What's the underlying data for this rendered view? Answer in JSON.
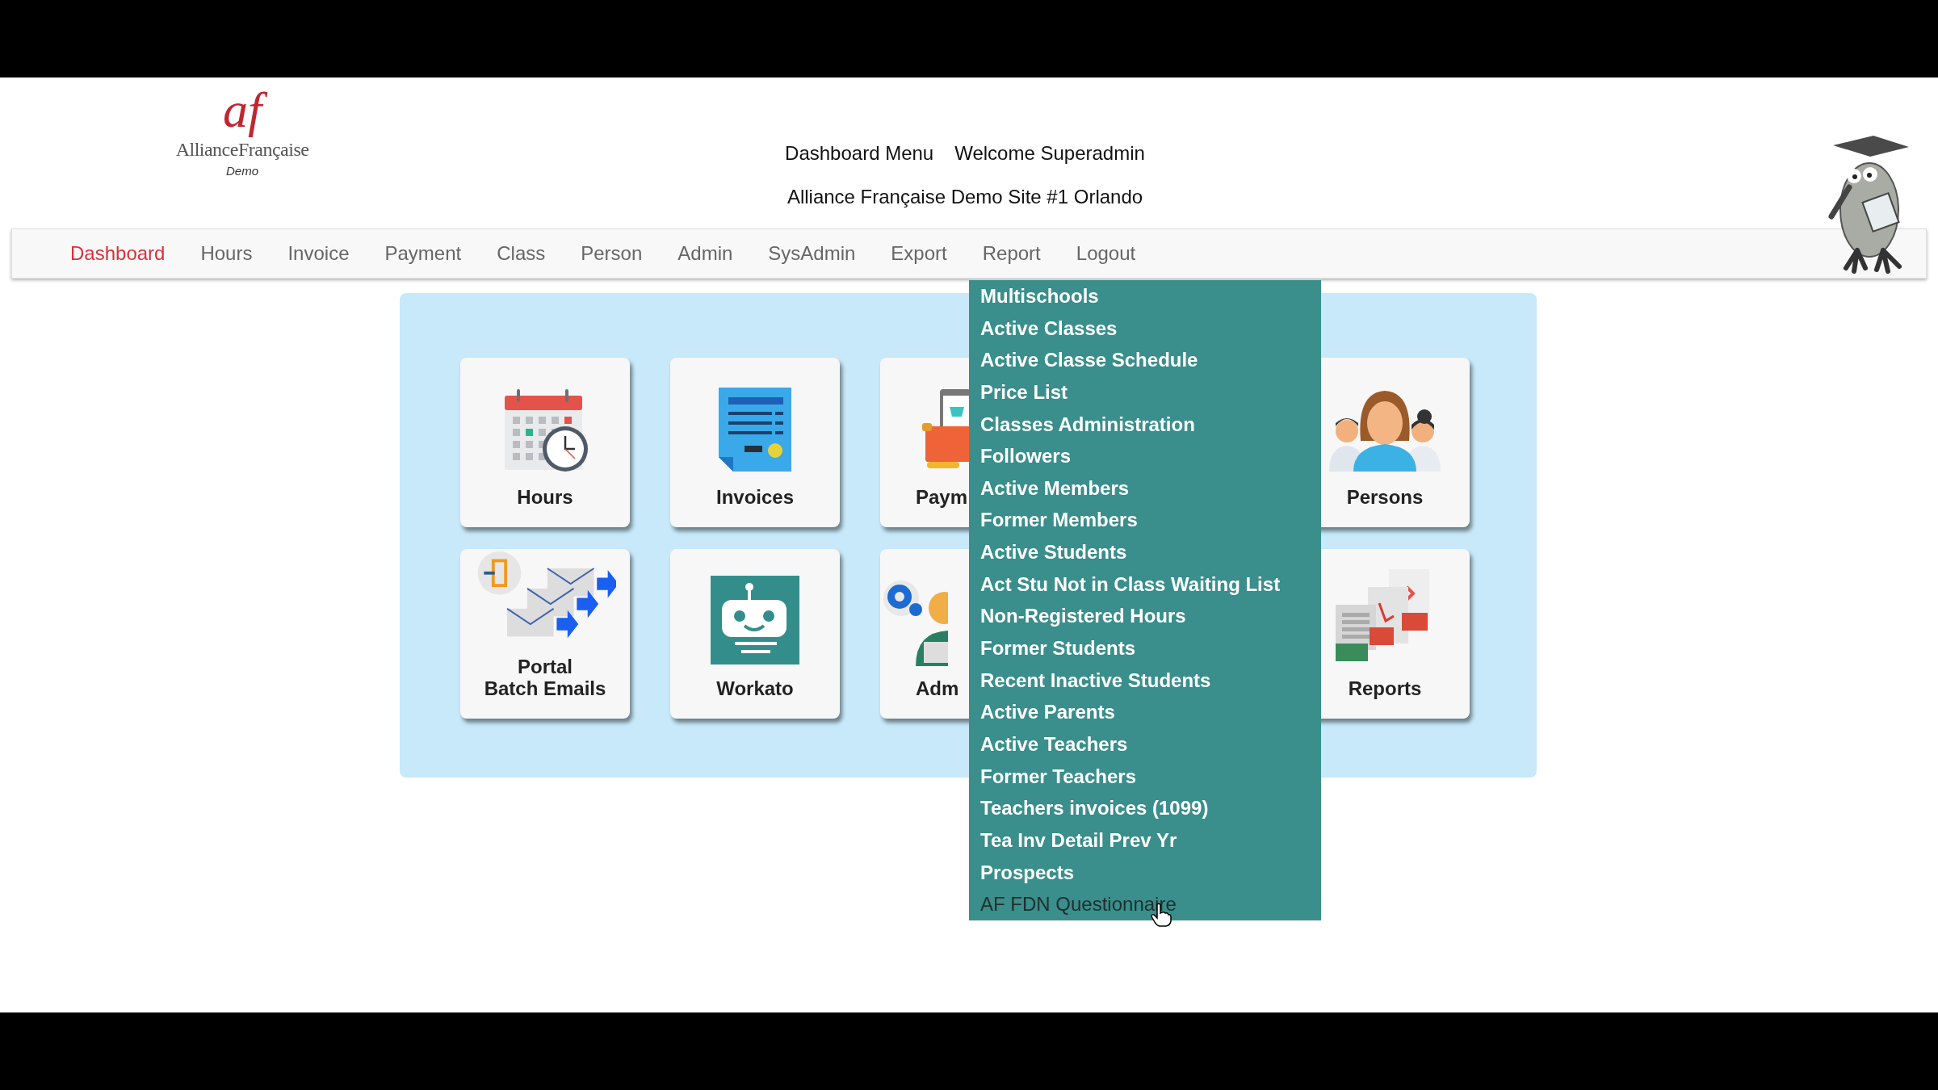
{
  "logo": {
    "mark": "af",
    "name": "AllianceFrançaise",
    "subtitle": "Demo"
  },
  "header": {
    "menu_title": "Dashboard Menu",
    "welcome": "Welcome Superadmin",
    "site": "Alliance Française Demo Site #1 Orlando"
  },
  "nav": [
    {
      "label": "Dashboard",
      "selected": true
    },
    {
      "label": "Hours",
      "selected": false
    },
    {
      "label": "Invoice",
      "selected": false
    },
    {
      "label": "Payment",
      "selected": false
    },
    {
      "label": "Class",
      "selected": false
    },
    {
      "label": "Person",
      "selected": false
    },
    {
      "label": "Admin",
      "selected": false
    },
    {
      "label": "SysAdmin",
      "selected": false
    },
    {
      "label": "Export",
      "selected": false
    },
    {
      "label": "Report",
      "selected": false
    },
    {
      "label": "Logout",
      "selected": false
    }
  ],
  "tiles": [
    {
      "label": "Hours",
      "kind": "hours",
      "covered": false
    },
    {
      "label": "Invoices",
      "kind": "invoices",
      "covered": false
    },
    {
      "label": "Paym",
      "kind": "payments",
      "covered": true
    },
    {
      "label": "Persons",
      "kind": "persons",
      "covered": false
    },
    {
      "label": "Portal\nBatch Emails",
      "kind": "emails",
      "covered": false
    },
    {
      "label": "Workato",
      "kind": "robot",
      "covered": false
    },
    {
      "label": "Adm",
      "kind": "admin",
      "covered": true
    },
    {
      "label": "Reports",
      "kind": "reports",
      "covered": false
    }
  ],
  "report_menu": {
    "items": [
      {
        "label": "Multischools",
        "hovered": false
      },
      {
        "label": "Active Classes",
        "hovered": false
      },
      {
        "label": "Active Classe Schedule",
        "hovered": false
      },
      {
        "label": "Price List",
        "hovered": false
      },
      {
        "label": "Classes Administration",
        "hovered": false
      },
      {
        "label": "Followers",
        "hovered": false
      },
      {
        "label": "Active Members",
        "hovered": false
      },
      {
        "label": "Former Members",
        "hovered": false
      },
      {
        "label": "Active Students",
        "hovered": false
      },
      {
        "label": "Act Stu Not in Class Waiting List",
        "hovered": false
      },
      {
        "label": "Non-Registered Hours",
        "hovered": false
      },
      {
        "label": "Former Students",
        "hovered": false
      },
      {
        "label": "Recent Inactive Students",
        "hovered": false
      },
      {
        "label": "Active Parents",
        "hovered": false
      },
      {
        "label": "Active Teachers",
        "hovered": false
      },
      {
        "label": "Former Teachers",
        "hovered": false
      },
      {
        "label": "Teachers invoices (1099)",
        "hovered": false
      },
      {
        "label": "Tea Inv Detail Prev Yr",
        "hovered": false
      },
      {
        "label": "Prospects",
        "hovered": false
      },
      {
        "label": "AF FDN Questionnaire",
        "hovered": true
      }
    ]
  }
}
